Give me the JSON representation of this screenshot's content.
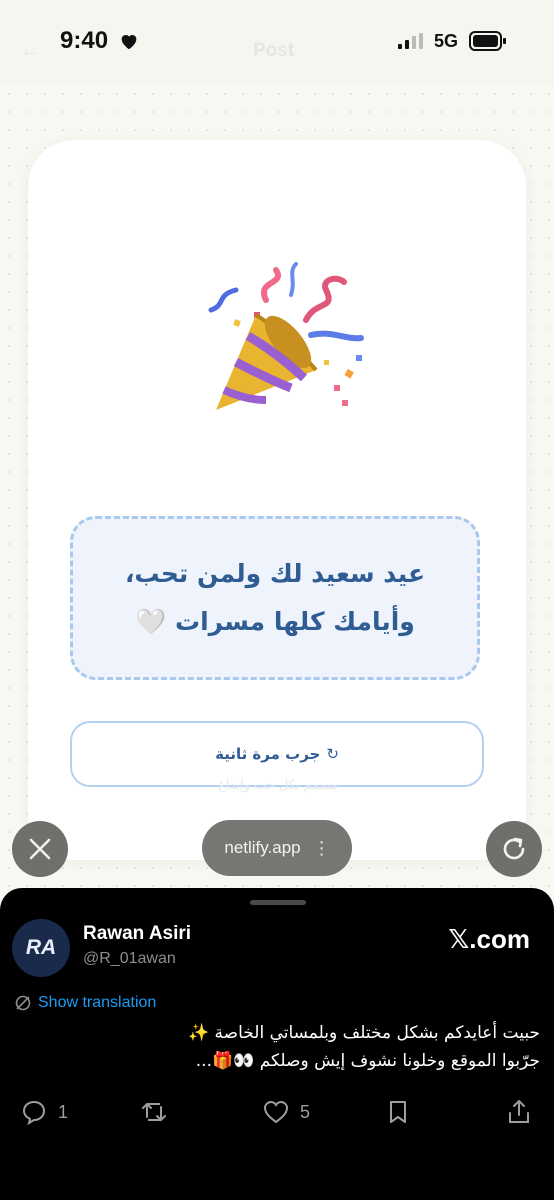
{
  "status_bar": {
    "time": "9:40",
    "network": "5G",
    "ghost_title": "Post"
  },
  "card": {
    "message_lines": [
      "عيد سعيد لك ولمن تحب،",
      "وأيامك كلها مسرات 🤍"
    ],
    "retry_label": "جرب مرة ثانية",
    "faded_text": "مصمم بكل حب وإبداع"
  },
  "browser": {
    "url": "netlify.app",
    "close_icon": "close-icon",
    "reload_icon": "reload-icon"
  },
  "tweet": {
    "avatar_initials": "RA",
    "name": "Rawan Asiri",
    "handle": "@R_01awan",
    "source": "𝕏.com",
    "show_translation": "Show translation",
    "text_lines": [
      "حبيت أعايدكم بشكل مختلف وبلمساتي الخاصة ✨",
      "جرّبوا الموقع وخلونا نشوف إيش وصلكم 👀🎁..."
    ],
    "reply_count": "1",
    "like_count": "5"
  },
  "colors": {
    "accent_blue": "#2f5d93",
    "dashed_border": "#a9c8ee",
    "link_blue": "#1d9bf0"
  }
}
